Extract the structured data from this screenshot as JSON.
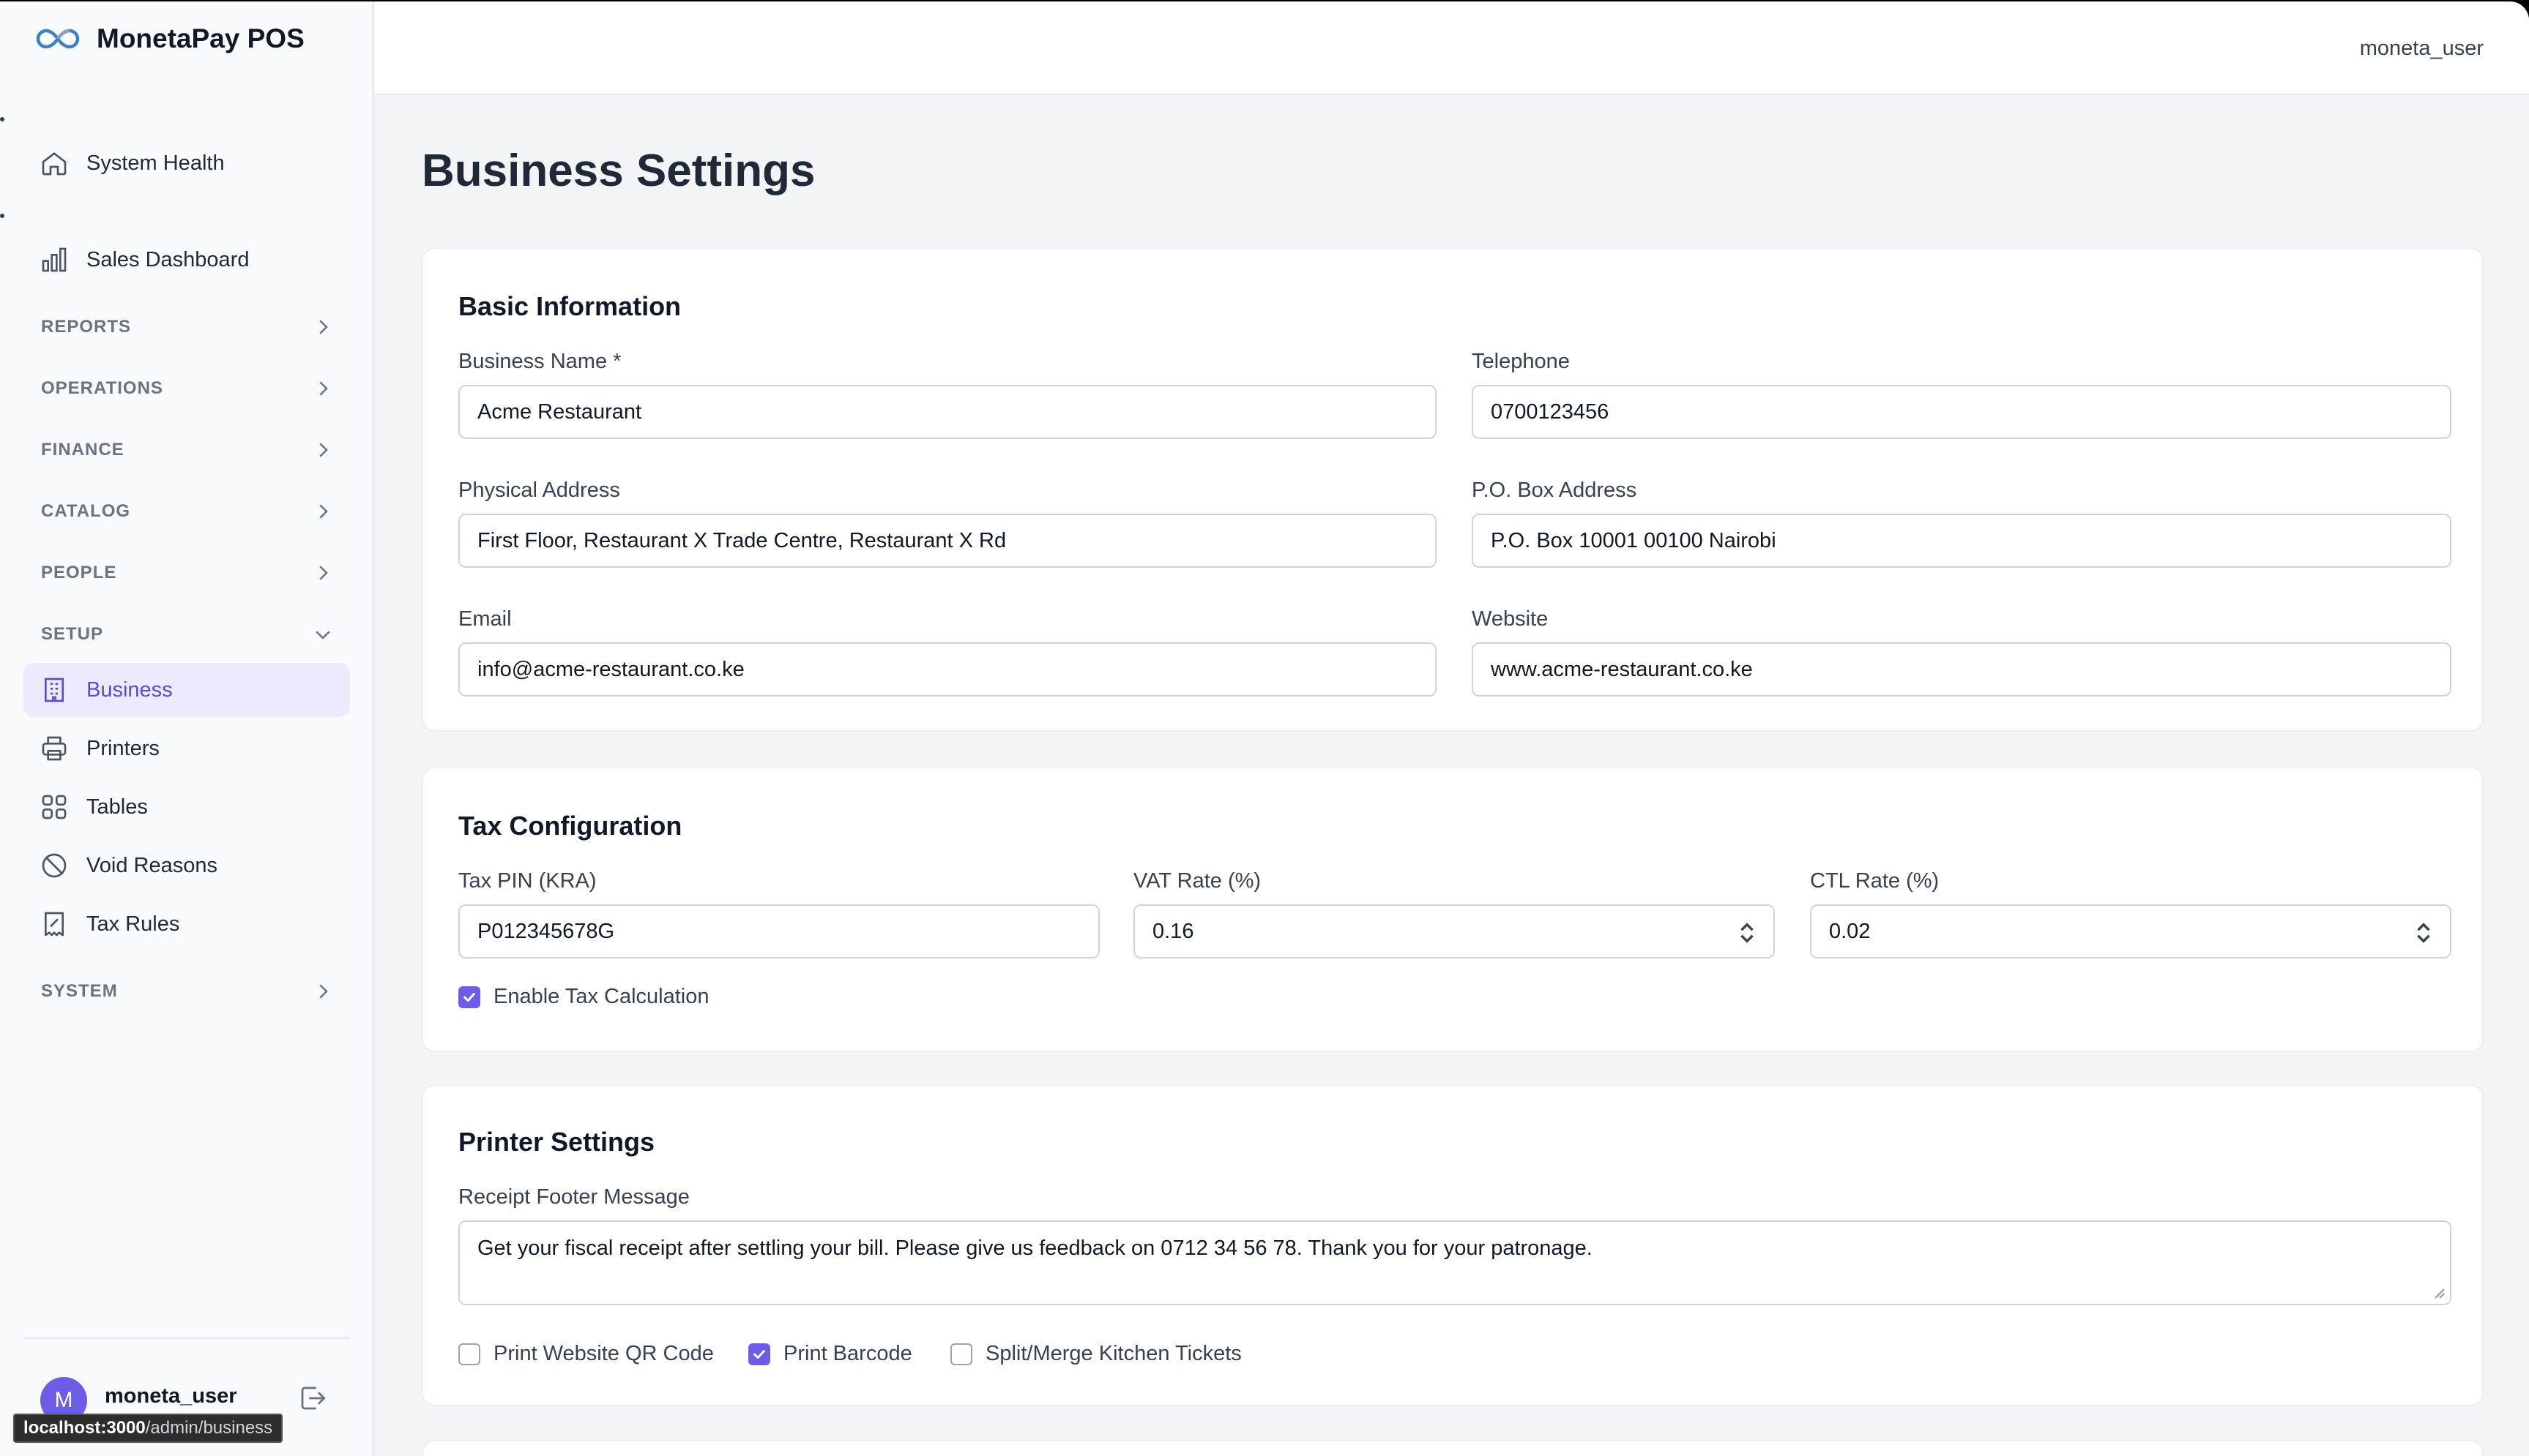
{
  "app": {
    "brand": "MonetaPay POS",
    "accent": "#6d5ce8"
  },
  "header": {
    "user": "moneta_user"
  },
  "sidebar": {
    "top_items": [
      {
        "label": "System Health",
        "icon": "home-icon"
      },
      {
        "label": "Sales Dashboard",
        "icon": "bar-chart-icon"
      }
    ],
    "sections": {
      "reports": "REPORTS",
      "operations": "OPERATIONS",
      "finance": "FINANCE",
      "catalog": "CATALOG",
      "people": "PEOPLE",
      "setup": "SETUP",
      "system": "SYSTEM"
    },
    "setup_items": [
      {
        "label": "Business",
        "icon": "building-icon",
        "active": true
      },
      {
        "label": "Printers",
        "icon": "printer-icon"
      },
      {
        "label": "Tables",
        "icon": "grid-icon"
      },
      {
        "label": "Void Reasons",
        "icon": "ban-icon"
      },
      {
        "label": "Tax Rules",
        "icon": "receipt-icon"
      }
    ],
    "user": {
      "initial": "M",
      "name": "moneta_user"
    }
  },
  "status_bar": {
    "host": "localhost:3000",
    "path": "/admin/business"
  },
  "page": {
    "title": "Business Settings"
  },
  "basic": {
    "title": "Basic Information",
    "business_name_label": "Business Name *",
    "business_name": "Acme Restaurant",
    "telephone_label": "Telephone",
    "telephone": "0700123456",
    "address_label": "Physical Address",
    "address": "First Floor, Restaurant X Trade Centre, Restaurant X Rd",
    "po_box_label": "P.O. Box Address",
    "po_box": "P.O. Box 10001 00100 Nairobi",
    "email_label": "Email",
    "email": "info@acme-restaurant.co.ke",
    "website_label": "Website",
    "website": "www.acme-restaurant.co.ke"
  },
  "tax": {
    "title": "Tax Configuration",
    "pin_label": "Tax PIN (KRA)",
    "pin": "P012345678G",
    "vat_label": "VAT Rate (%)",
    "vat": "0.16",
    "ctl_label": "CTL Rate (%)",
    "ctl": "0.02",
    "enable_label": "Enable Tax Calculation",
    "enable_checked": true
  },
  "printer": {
    "title": "Printer Settings",
    "footer_label": "Receipt Footer Message",
    "footer": "Get your fiscal receipt after settling your bill. Please give us feedback on 0712 34 56 78. Thank you for your patronage.",
    "qr_label": "Print Website QR Code",
    "qr_checked": false,
    "barcode_label": "Print Barcode",
    "barcode_checked": true,
    "split_label": "Split/Merge Kitchen Tickets",
    "split_checked": false
  }
}
